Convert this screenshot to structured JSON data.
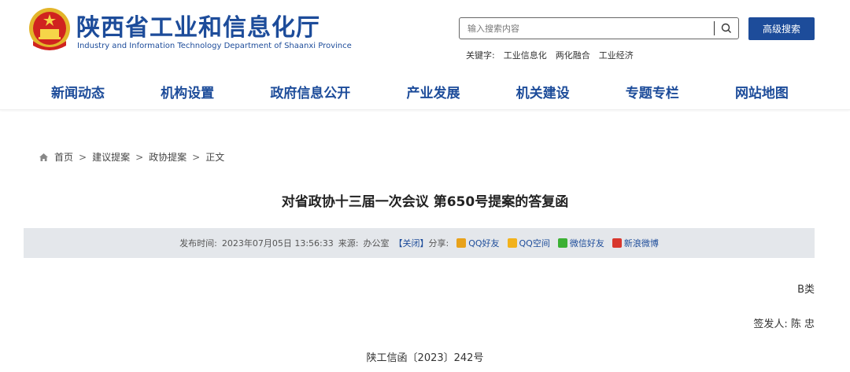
{
  "header": {
    "site_title": "陕西省工业和信息化厅",
    "site_subtitle": "Industry and Information Technology Department of Shaanxi Province",
    "search_placeholder": "输入搜索内容",
    "advanced_search": "高级搜索",
    "keywords_label": "关键字:",
    "keywords": [
      "工业信息化",
      "两化融合",
      "工业经济"
    ]
  },
  "nav": [
    "新闻动态",
    "机构设置",
    "政府信息公开",
    "产业发展",
    "机关建设",
    "专题专栏",
    "网站地图"
  ],
  "breadcrumb": {
    "home": "首页",
    "items": [
      "建议提案",
      "政协提案",
      "正文"
    ],
    "separator": ">"
  },
  "article": {
    "title": "对省政协十三届一次会议 第650号提案的答复函",
    "meta": {
      "publish_label": "发布时间:",
      "publish_time": "2023年07月05日 13:56:33",
      "source_label": "来源:",
      "source": "办公室",
      "close": "【关闭】",
      "share_label": "分享:",
      "share": [
        {
          "label": "QQ好友",
          "icon": "qq-icon",
          "color": "#e8a21b"
        },
        {
          "label": "QQ空间",
          "icon": "qzone-icon",
          "color": "#f2b21c"
        },
        {
          "label": "微信好友",
          "icon": "wechat-icon",
          "color": "#3cb034"
        },
        {
          "label": "新浪微博",
          "icon": "weibo-icon",
          "color": "#d8372d"
        }
      ]
    },
    "classification": "B类",
    "signer": "签发人: 陈 忠",
    "doc_number": "陕工信函〔2023〕242号"
  },
  "colors": {
    "brand": "#1d4c9a",
    "meta_bg": "#e4e7eb"
  }
}
